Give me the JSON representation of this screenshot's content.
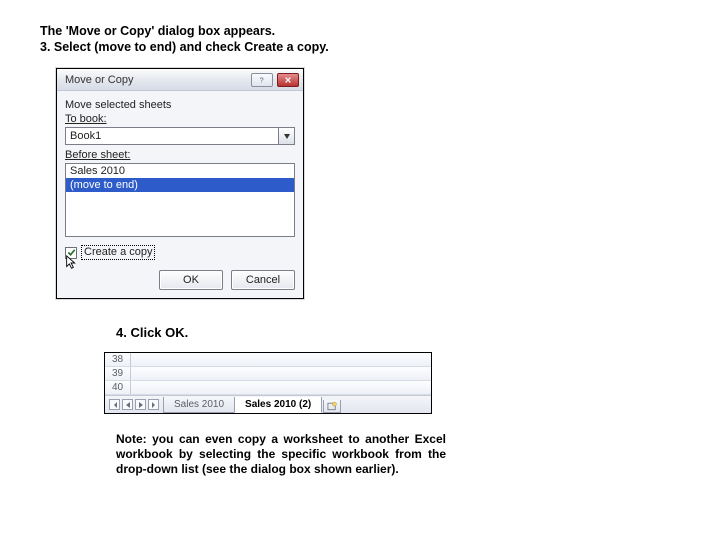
{
  "intro": {
    "line1": "The 'Move or Copy' dialog box appears.",
    "line2": "3. Select (move to end) and check Create a  copy."
  },
  "dialog": {
    "title": "Move or Copy",
    "move_selected": "Move selected sheets",
    "to_book": "To book:",
    "book_value": "Book1",
    "before_sheet": "Before sheet:",
    "list": {
      "item0": "Sales 2010",
      "item1": "(move to end)"
    },
    "create_copy": "Create a copy",
    "ok": "OK",
    "cancel": "Cancel"
  },
  "step4": "4. Click OK.",
  "sheet": {
    "rows": {
      "r0": "38",
      "r1": "39",
      "r2": "40"
    },
    "tabs": {
      "t0": "Sales 2010",
      "t1": "Sales 2010 (2)"
    }
  },
  "note": "Note: you can even copy a worksheet to another Excel workbook by selecting the specific workbook from the drop-down list (see the dialog box shown earlier)."
}
